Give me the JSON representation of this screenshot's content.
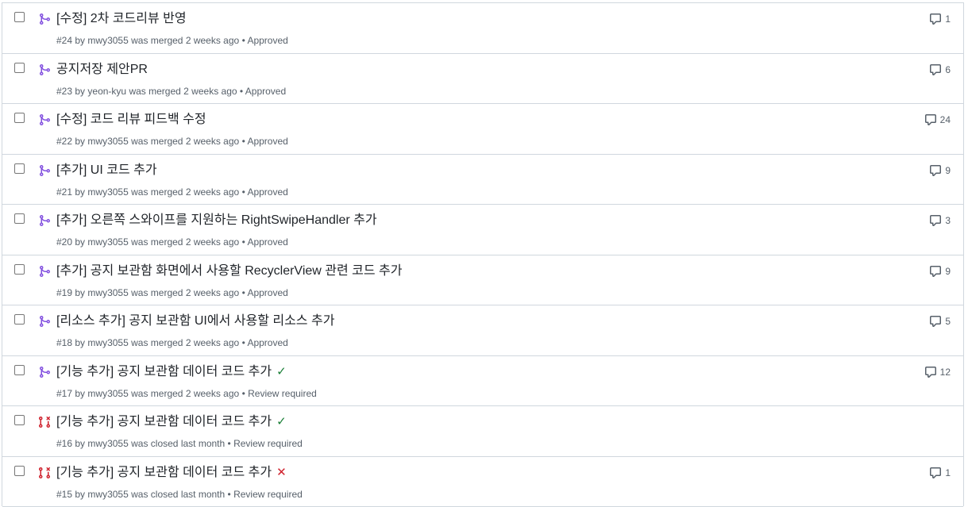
{
  "pull_requests": [
    {
      "title": "[수정] 2차 코드리뷰 반영",
      "number": "#24",
      "author": "mwy3055",
      "status_text": "was merged",
      "time": "2 weeks ago",
      "review": "Approved",
      "comments": "1",
      "state": "merged",
      "ci": ""
    },
    {
      "title": "공지저장 제안PR",
      "number": "#23",
      "author": "yeon-kyu",
      "status_text": "was merged",
      "time": "2 weeks ago",
      "review": "Approved",
      "comments": "6",
      "state": "merged",
      "ci": ""
    },
    {
      "title": "[수정] 코드 리뷰 피드백 수정",
      "number": "#22",
      "author": "mwy3055",
      "status_text": "was merged",
      "time": "2 weeks ago",
      "review": "Approved",
      "comments": "24",
      "state": "merged",
      "ci": ""
    },
    {
      "title": "[추가] UI 코드 추가",
      "number": "#21",
      "author": "mwy3055",
      "status_text": "was merged",
      "time": "2 weeks ago",
      "review": "Approved",
      "comments": "9",
      "state": "merged",
      "ci": ""
    },
    {
      "title": "[추가] 오른쪽 스와이프를 지원하는 RightSwipeHandler 추가",
      "number": "#20",
      "author": "mwy3055",
      "status_text": "was merged",
      "time": "2 weeks ago",
      "review": "Approved",
      "comments": "3",
      "state": "merged",
      "ci": ""
    },
    {
      "title": "[추가] 공지 보관함 화면에서 사용할 RecyclerView 관련 코드 추가",
      "number": "#19",
      "author": "mwy3055",
      "status_text": "was merged",
      "time": "2 weeks ago",
      "review": "Approved",
      "comments": "9",
      "state": "merged",
      "ci": ""
    },
    {
      "title": "[리소스 추가] 공지 보관함 UI에서 사용할 리소스 추가",
      "number": "#18",
      "author": "mwy3055",
      "status_text": "was merged",
      "time": "2 weeks ago",
      "review": "Approved",
      "comments": "5",
      "state": "merged",
      "ci": ""
    },
    {
      "title": "[기능 추가] 공지 보관함 데이터 코드 추가",
      "number": "#17",
      "author": "mwy3055",
      "status_text": "was merged",
      "time": "2 weeks ago",
      "review": "Review required",
      "comments": "12",
      "state": "merged",
      "ci": "success"
    },
    {
      "title": "[기능 추가] 공지 보관함 데이터 코드 추가",
      "number": "#16",
      "author": "mwy3055",
      "status_text": "was closed",
      "time": "last month",
      "review": "Review required",
      "comments": "",
      "state": "closed",
      "ci": "success"
    },
    {
      "title": "[기능 추가] 공지 보관함 데이터 코드 추가",
      "number": "#15",
      "author": "mwy3055",
      "status_text": "was closed",
      "time": "last month",
      "review": "Review required",
      "comments": "1",
      "state": "closed",
      "ci": "failure"
    }
  ],
  "colors": {
    "merged": "#8250df",
    "closed": "#cf222e",
    "success": "#1a7f37",
    "failure": "#cf222e",
    "muted": "#57606a"
  },
  "icons": {
    "merged": "git-merge-icon",
    "closed": "git-pull-request-closed-icon",
    "comment": "comment-icon",
    "success": "check-icon",
    "failure": "x-icon"
  },
  "labels": {
    "by": "by",
    "separator": "•",
    "check": "✓",
    "cross": "✕"
  }
}
